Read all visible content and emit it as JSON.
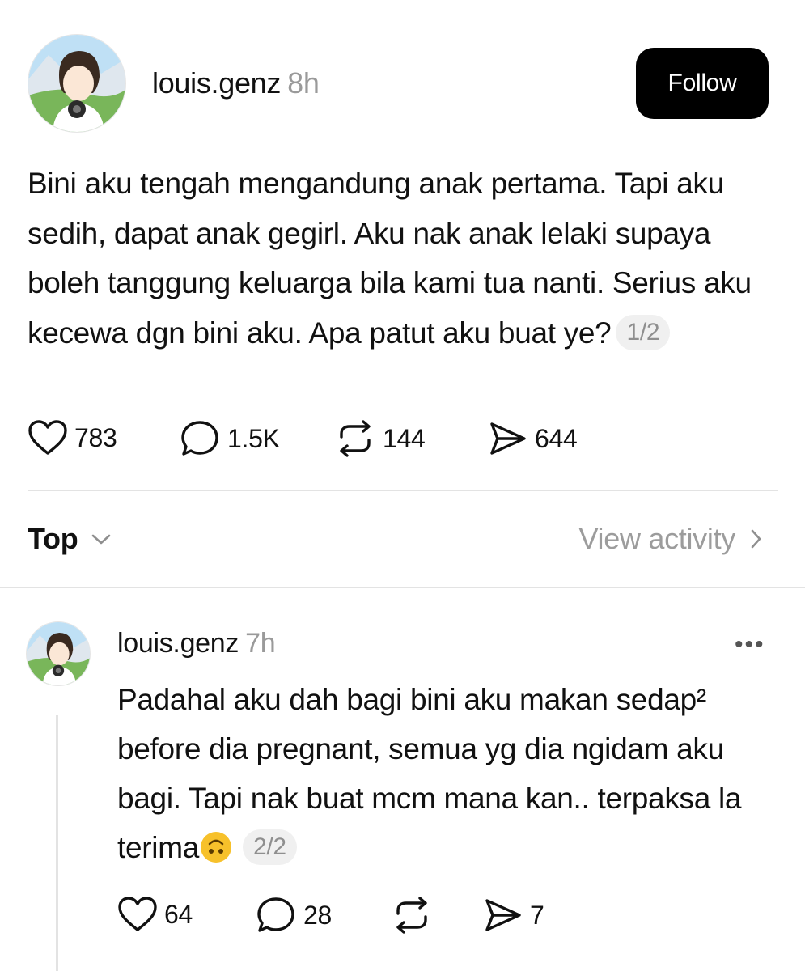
{
  "post": {
    "username": "louis.genz",
    "time": "8h",
    "follow_label": "Follow",
    "text": "Bini aku tengah mengandung anak pertama. Tapi aku sedih, dapat anak gegirl. Aku nak anak lelaki supaya boleh tanggung keluarga bila kami tua nanti. Serius aku kecewa dgn bini aku. Apa patut aku buat ye?",
    "pager": "1/2",
    "likes": "783",
    "comments": "1.5K",
    "reposts": "144",
    "shares": "644"
  },
  "sort": {
    "label": "Top",
    "view_activity": "View activity"
  },
  "reply": {
    "username": "louis.genz",
    "time": "7h",
    "text": "Padahal aku dah bagi bini aku makan sedap² before dia pregnant, semua yg dia ngidam aku bagi. Tapi nak buat mcm mana kan.. terpaksa la terima",
    "pager": "2/2",
    "likes": "64",
    "comments": "28",
    "reposts": "",
    "shares": "7",
    "more_label": "•••"
  },
  "icons": {
    "like": "heart-icon",
    "comment": "speech-bubble-icon",
    "repost": "repost-icon",
    "share": "paper-plane-icon",
    "more": "more-dots-icon",
    "chevron_down": "chevron-down-icon",
    "chevron_right": "chevron-right-icon",
    "emoji": "upside-down-face-emoji"
  },
  "colors": {
    "follow_bg": "#000000",
    "muted_text": "#9a9a9a",
    "divider": "#e3e3e3"
  }
}
